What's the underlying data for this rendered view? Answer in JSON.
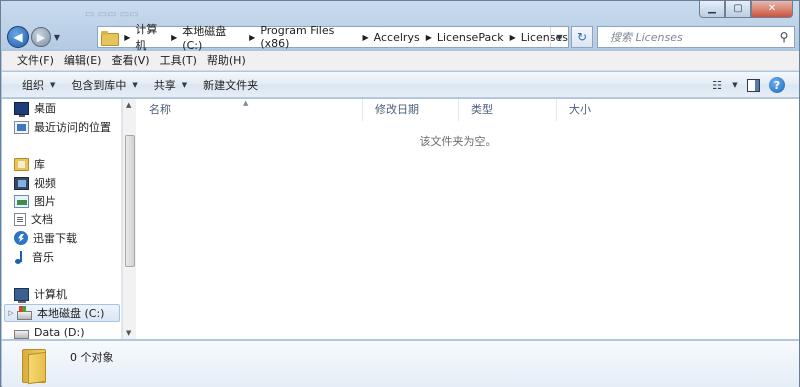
{
  "window": {
    "caption_buttons": [
      "minimize-icon",
      "maximize-icon",
      "close-icon"
    ],
    "accent_color": "#1f5eab"
  },
  "address_bar": {
    "breadcrumbs": [
      "计算机",
      "本地磁盘 (C:)",
      "Program Files (x86)",
      "Accelrys",
      "LicensePack",
      "Licenses"
    ]
  },
  "search": {
    "placeholder": "搜索 Licenses"
  },
  "menu": {
    "items": [
      "文件(F)",
      "编辑(E)",
      "查看(V)",
      "工具(T)",
      "帮助(H)"
    ]
  },
  "toolbar": {
    "organize": "组织",
    "include_library": "包含到库中",
    "share": "共享",
    "new_folder": "新建文件夹"
  },
  "nav_pane": {
    "favorites": [
      {
        "label": "桌面",
        "icon": "desktop-icon"
      },
      {
        "label": "最近访问的位置",
        "icon": "recent-places-icon"
      }
    ],
    "library": {
      "label": "库",
      "icon": "library-icon"
    },
    "libraries": [
      {
        "label": "视频",
        "icon": "video-icon"
      },
      {
        "label": "图片",
        "icon": "pictures-icon"
      },
      {
        "label": "文档",
        "icon": "documents-icon"
      },
      {
        "label": "迅雷下载",
        "icon": "thunder-download-icon"
      },
      {
        "label": "音乐",
        "icon": "music-icon"
      }
    ],
    "computer": {
      "label": "计算机",
      "icon": "computer-icon"
    },
    "drives": [
      {
        "label": "本地磁盘 (C:)",
        "icon": "windows-drive-icon",
        "selected": true
      },
      {
        "label": "Data (D:)",
        "icon": "drive-icon",
        "selected": false
      }
    ]
  },
  "columns": {
    "name": "名称",
    "date_modified": "修改日期",
    "type": "类型",
    "size": "大小"
  },
  "content": {
    "empty_message": "该文件夹为空。"
  },
  "details": {
    "item_count": "0 个对象"
  }
}
